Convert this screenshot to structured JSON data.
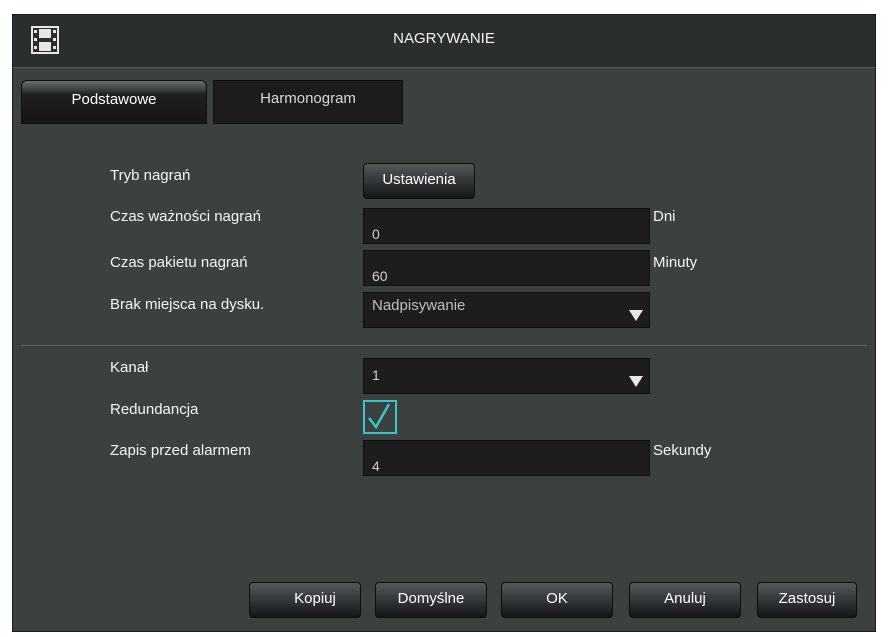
{
  "window": {
    "title": "NAGRYWANIE",
    "icon": "film-icon"
  },
  "tabs": [
    {
      "label": "Podstawowe",
      "active": true
    },
    {
      "label": "Harmonogram",
      "active": false
    }
  ],
  "settings": {
    "record_mode": {
      "label": "Tryb nagrań",
      "button_label": "Ustawienia"
    },
    "retention": {
      "label": "Czas ważności nagrań",
      "value": "0",
      "unit": "Dni"
    },
    "package_time": {
      "label": "Czas pakietu nagrań",
      "value": "60",
      "unit": "Minuty"
    },
    "disk_full": {
      "label": "Brak miejsca na dysku.",
      "value": "Nadpisywanie"
    }
  },
  "channel": {
    "label": "Kanał",
    "value": "1"
  },
  "redundancy": {
    "label": "Redundancja",
    "checked": true
  },
  "pre_record": {
    "label": "Zapis przed alarmem",
    "value": "4",
    "unit": "Sekundy"
  },
  "buttons": {
    "copy": "Kopiuj",
    "defaults": "Domyślne",
    "ok": "OK",
    "cancel": "Anuluj",
    "apply": "Zastosuj"
  },
  "colors": {
    "window_bg": "#3c4140",
    "titlebar_bg": "#2b2e2e",
    "field_bg": "#1c1d1d",
    "checkbox_accent": "#35c7d0"
  }
}
